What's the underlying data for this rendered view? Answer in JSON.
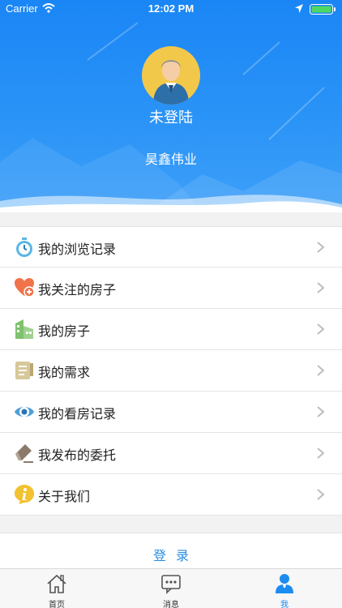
{
  "status_bar": {
    "carrier": "Carrier",
    "time": "12:02 PM"
  },
  "profile": {
    "login_status": "未登陆",
    "company": "昊鑫伟业"
  },
  "menu": [
    {
      "label": "我的浏览记录",
      "icon": "stopwatch-icon"
    },
    {
      "label": "我关注的房子",
      "icon": "heart-plus-icon"
    },
    {
      "label": "我的房子",
      "icon": "building-icon"
    },
    {
      "label": "我的需求",
      "icon": "document-list-icon"
    },
    {
      "label": "我的看房记录",
      "icon": "eye-icon"
    },
    {
      "label": "我发布的委托",
      "icon": "eraser-pencil-icon"
    },
    {
      "label": "关于我们",
      "icon": "info-icon"
    }
  ],
  "login_button": "登录",
  "tabbar": [
    {
      "label": "首页",
      "icon": "home-icon",
      "active": false
    },
    {
      "label": "消息",
      "icon": "message-icon",
      "active": false
    },
    {
      "label": "我",
      "icon": "person-icon",
      "active": true
    }
  ],
  "colors": {
    "hero_blue": "#1a86f5",
    "accent": "#2b8de6",
    "tab_active": "#1c8cf0",
    "avatar_bg": "#f2c84b"
  }
}
